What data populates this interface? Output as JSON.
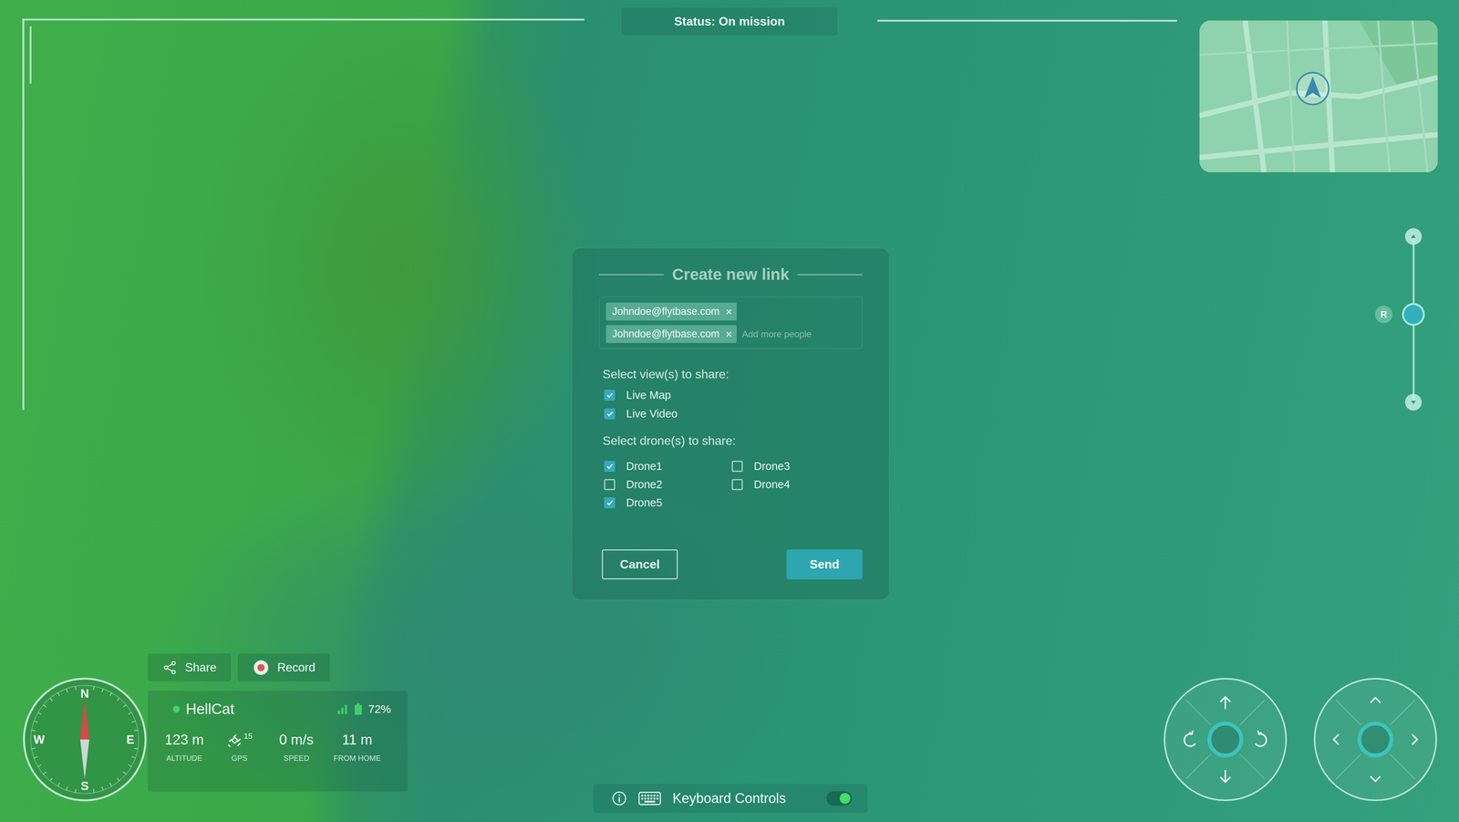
{
  "status": "Status: On mission",
  "dialog": {
    "title": "Create new link",
    "recipients": [
      {
        "email": "Johndoe@flytbase.com",
        "remove": "×"
      },
      {
        "email": "Johndoe@flytbase.com",
        "remove": "×"
      }
    ],
    "placeholder": "Add more people",
    "views_label": "Select view(s) to share:",
    "views": [
      {
        "label": "Live Map",
        "checked": true
      },
      {
        "label": "Live Video",
        "checked": true
      }
    ],
    "drones_label": "Select drone(s) to share:",
    "drones": [
      {
        "label": "Drone1",
        "checked": true
      },
      {
        "label": "Drone2",
        "checked": false
      },
      {
        "label": "Drone5",
        "checked": true
      },
      {
        "label": "Drone3",
        "checked": false
      },
      {
        "label": "Drone4",
        "checked": false
      }
    ],
    "buttons": [
      {
        "label": "Cancel",
        "kind": "secondary"
      },
      {
        "label": "Send",
        "kind": "primary"
      }
    ]
  },
  "toolbar": [
    {
      "label": "Share",
      "kind": "share"
    },
    {
      "label": "Record",
      "kind": "record"
    }
  ],
  "drone": {
    "name": "HellCat",
    "online": true,
    "battery": "72%",
    "stats": [
      {
        "value": "123 m",
        "label": "ALTITUDE",
        "kind": "value"
      },
      {
        "value": "15",
        "label": "GPS",
        "kind": "gps"
      },
      {
        "value": "0 m/s",
        "label": "SPEED",
        "kind": "value"
      },
      {
        "value": "11 m",
        "label": "FROM HOME",
        "kind": "value"
      }
    ]
  },
  "compass": {
    "north": "N",
    "east": "E",
    "south": "S",
    "west": "W"
  },
  "slider": {
    "badge": "R",
    "level": 0.53
  },
  "keyboard": {
    "label": "Keyboard Controls",
    "on": true
  }
}
